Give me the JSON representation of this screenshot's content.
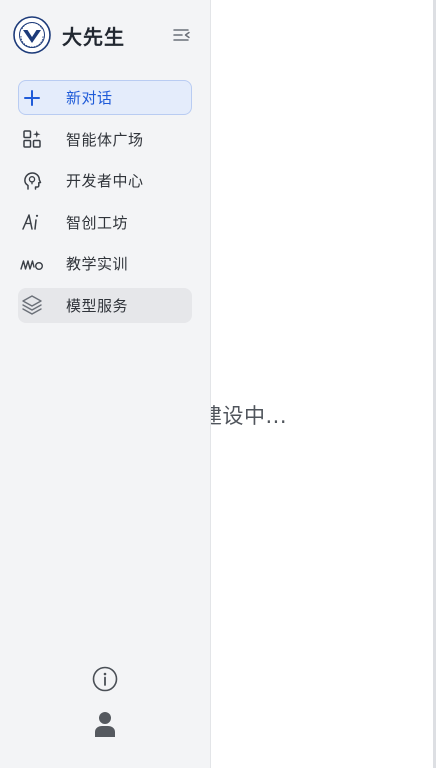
{
  "brand": {
    "name": "大先生",
    "logo_icon": "university-seal-icon"
  },
  "sidebar": {
    "collapse_icon": "collapse-sidebar-icon",
    "items": [
      {
        "id": "new-chat",
        "label": "新对话",
        "icon": "plus-icon",
        "state": "active"
      },
      {
        "id": "agent-square",
        "label": "智能体广场",
        "icon": "apps-grid-icon",
        "state": "normal"
      },
      {
        "id": "developer-center",
        "label": "开发者中心",
        "icon": "head-bulb-icon",
        "state": "normal"
      },
      {
        "id": "creative-workshop",
        "label": "智创工坊",
        "icon": "ai-text-icon",
        "state": "normal"
      },
      {
        "id": "teaching-practice",
        "label": "教学实训",
        "icon": "waves-icon",
        "state": "normal"
      },
      {
        "id": "model-service",
        "label": "模型服务",
        "icon": "layers-icon",
        "state": "hover"
      }
    ],
    "footer": {
      "info_icon": "info-icon",
      "user_icon": "user-icon"
    }
  },
  "main": {
    "placeholder": "建设中..."
  },
  "colors": {
    "sidebar_bg": "#f3f4f6",
    "accent": "#1f5bd8",
    "active_bg": "#e4ecfb",
    "hover_bg": "#e6e7ea"
  }
}
